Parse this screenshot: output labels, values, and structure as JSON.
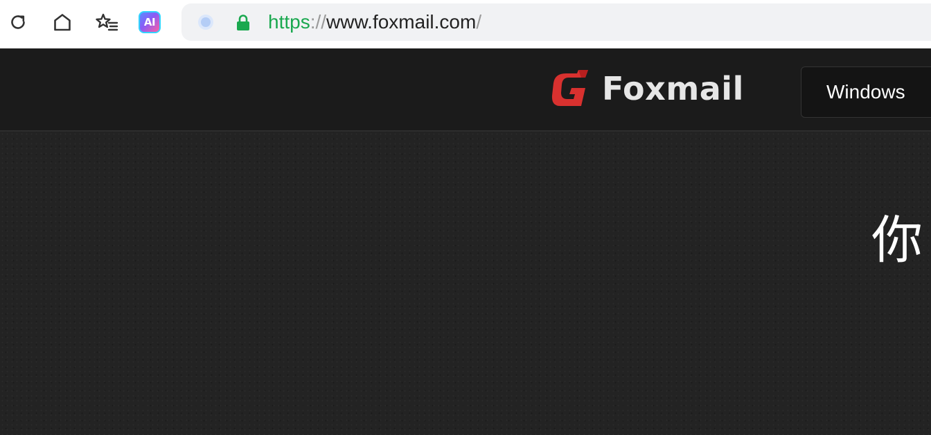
{
  "browser": {
    "toolbar": {
      "reload_icon": "reload-icon",
      "home_icon": "home-icon",
      "favorites_icon": "favorites-icon",
      "ai_label": "AI"
    },
    "address_bar": {
      "url_scheme": "https",
      "url_separator": "://",
      "url_host": "www.foxmail.com",
      "url_path": "/",
      "secure": true
    }
  },
  "site": {
    "logo_text": "Foxmail",
    "nav": {
      "windows_label": "Windows"
    },
    "hero": {
      "text": "你"
    }
  },
  "colors": {
    "url_scheme": "#1aa84f",
    "lock": "#1aa84f",
    "logo_red": "#d8312f",
    "header_bg": "#1b1b1b",
    "hero_bg": "#232323"
  }
}
